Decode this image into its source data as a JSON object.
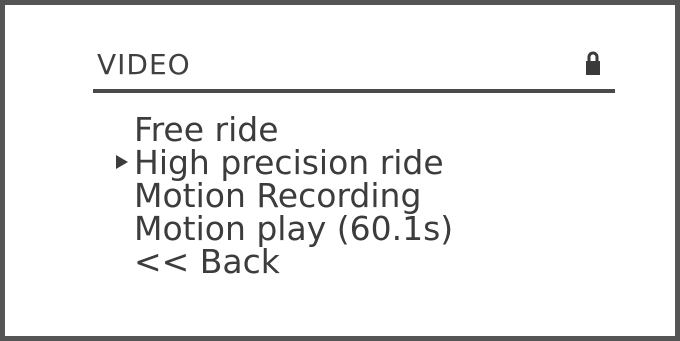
{
  "screen": {
    "title": "VIDEO",
    "status_icon": "lock-icon"
  },
  "menu": {
    "selected_index": 1,
    "items": [
      {
        "label": "Free ride"
      },
      {
        "label": "High precision ride"
      },
      {
        "label": "Motion Recording"
      },
      {
        "label": "Motion play (60.1s)"
      },
      {
        "label": "<< Back"
      }
    ]
  }
}
